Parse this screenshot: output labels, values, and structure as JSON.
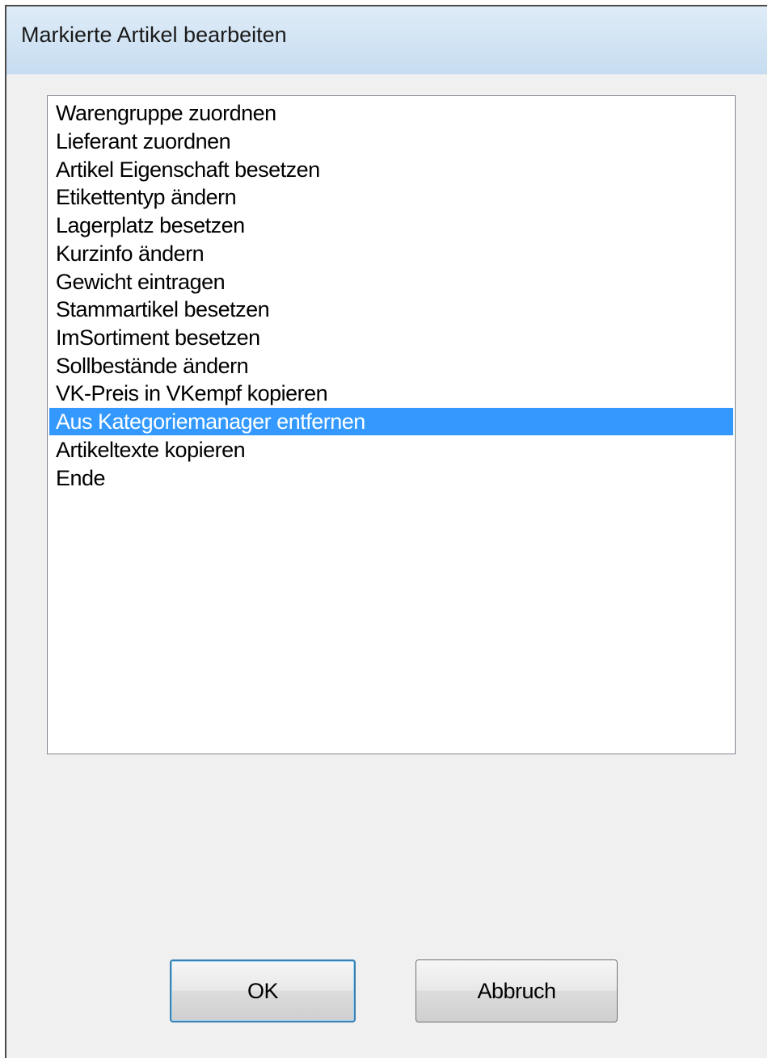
{
  "window": {
    "title": "Markierte Artikel bearbeiten"
  },
  "list": {
    "items": [
      "Warengruppe zuordnen",
      "Lieferant zuordnen",
      "Artikel Eigenschaft besetzen",
      "Etikettentyp ändern",
      "Lagerplatz besetzen",
      "Kurzinfo ändern",
      "Gewicht eintragen",
      "Stammartikel besetzen",
      "ImSortiment besetzen",
      "Sollbestände ändern",
      "VK-Preis in VKempf kopieren",
      "Aus Kategoriemanager entfernen",
      "Artikeltexte kopieren",
      "Ende"
    ],
    "selected_item": "Aus Kategoriemanager entfernen"
  },
  "buttons": {
    "ok_label": "OK",
    "cancel_label": "Abbruch"
  },
  "colors": {
    "selection": "#3399ff",
    "titlebar": "#c6dcf0",
    "dialog_background": "#f0f0f0"
  }
}
